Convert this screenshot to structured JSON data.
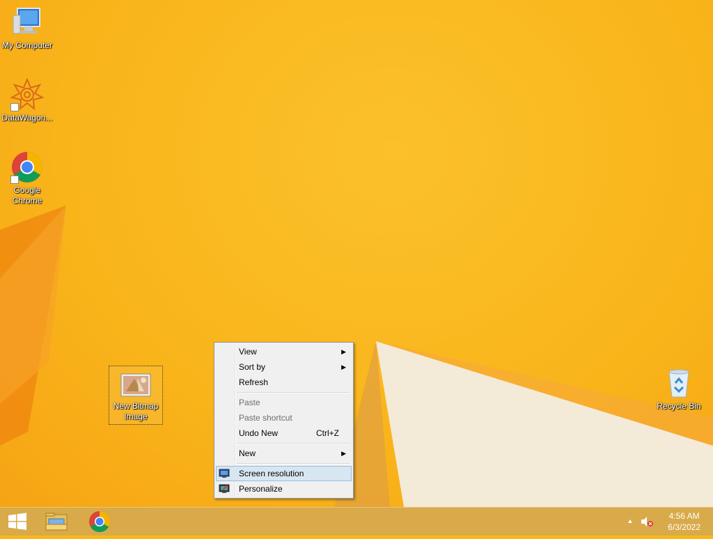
{
  "desktop": {
    "icons": [
      {
        "label": "My Computer"
      },
      {
        "label": "DataWagon..."
      },
      {
        "label": "Google Chrome"
      },
      {
        "label": "New Bitmap Image"
      },
      {
        "label": "Recycle Bin"
      }
    ]
  },
  "context_menu": {
    "items": [
      {
        "label": "View",
        "submenu": true
      },
      {
        "label": "Sort by",
        "submenu": true
      },
      {
        "label": "Refresh"
      },
      {
        "label": "Paste",
        "disabled": true
      },
      {
        "label": "Paste shortcut",
        "disabled": true
      },
      {
        "label": "Undo New",
        "shortcut": "Ctrl+Z"
      },
      {
        "label": "New",
        "submenu": true
      },
      {
        "label": "Screen resolution",
        "icon": "monitor-icon",
        "highlighted": true
      },
      {
        "label": "Personalize",
        "icon": "personalize-icon"
      }
    ]
  },
  "taskbar": {
    "start": "windows-logo-icon",
    "pinned": [
      "file-explorer-icon",
      "chrome-icon"
    ],
    "tray": {
      "time": "4:56 AM",
      "date": "6/3/2022"
    }
  },
  "colors": {
    "wallpaper": "#f9b81a",
    "menu_bg": "#f0f0f0",
    "menu_highlight": "#d8e6f2",
    "menu_highlight_border": "#98bde0"
  }
}
